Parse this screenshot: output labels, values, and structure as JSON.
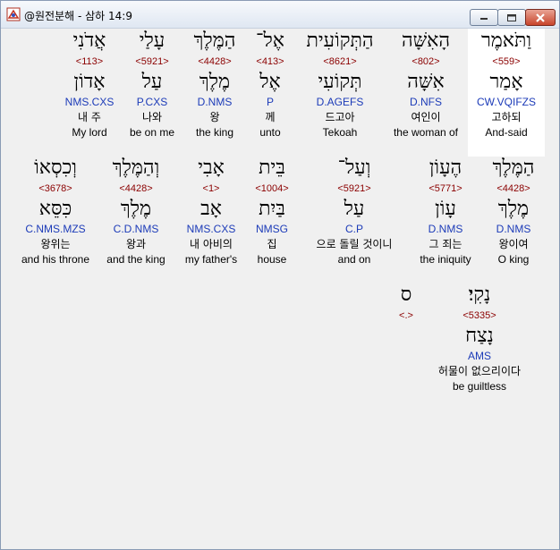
{
  "window": {
    "title": "@원전분해 - 삼하 14:9"
  },
  "rows": [
    [
      {
        "heb": "וַתֹּאמֶר",
        "strong": "<559>",
        "lemma": "אָמַר",
        "morph": "CW.VQIFZS",
        "kor": "고하되",
        "eng": "And-said"
      },
      {
        "heb": "הָאִשָּׁה",
        "strong": "<802>",
        "lemma": "אִשָּׁה",
        "morph": "D.NFS",
        "kor": "여인이",
        "eng": "the woman of"
      },
      {
        "heb": "הַתְּקוֹעִית",
        "strong": "<8621>",
        "lemma": "תְּקוֹעִי",
        "morph": "D.AGEFS",
        "kor": "드고아",
        "eng": "Tekoah"
      },
      {
        "heb": "אֶל־",
        "strong": "<413>",
        "lemma": "אֶל",
        "morph": "P",
        "kor": "께",
        "eng": "unto"
      },
      {
        "heb": "הַמֶּלֶךְ",
        "strong": "<4428>",
        "lemma": "מֶלֶךְ",
        "morph": "D.NMS",
        "kor": "왕",
        "eng": "the king"
      },
      {
        "heb": "עָלַי",
        "strong": "<5921>",
        "lemma": "עַל",
        "morph": "P.CXS",
        "kor": "나와",
        "eng": "be on me"
      },
      {
        "heb": "אֲדֹנִי",
        "strong": "<113>",
        "lemma": "אָדוֹן",
        "morph": "NMS.CXS",
        "kor": "내 주",
        "eng": "My lord"
      }
    ],
    [
      {
        "heb": "הַמֶּלֶךְ",
        "strong": "<4428>",
        "lemma": "מֶלֶךְ",
        "morph": "D.NMS",
        "kor": "왕이여",
        "eng": "O king"
      },
      {
        "heb": "הֶעָוֹן",
        "strong": "<5771>",
        "lemma": "עָוֹן",
        "morph": "D.NMS",
        "kor": "그 죄는",
        "eng": "the iniquity"
      },
      {
        "heb": "וְעַל־",
        "strong": "<5921>",
        "lemma": "עַל",
        "morph": "C.P",
        "kor": "으로 돌릴 것이니",
        "eng": "and on"
      },
      {
        "heb": "בֵּית",
        "strong": "<1004>",
        "lemma": "בַּיִת",
        "morph": "NMSG",
        "kor": "집",
        "eng": "house"
      },
      {
        "heb": "אָבִי",
        "strong": "<1>",
        "lemma": "אָב",
        "morph": "NMS.CXS",
        "kor": "내 아비의",
        "eng": "my father's"
      },
      {
        "heb": "וְהַמֶּלֶךְ",
        "strong": "<4428>",
        "lemma": "מֶלֶךְ",
        "morph": "C.D.NMS",
        "kor": "왕과",
        "eng": "and the king"
      },
      {
        "heb": "וְכִסְאוֹ",
        "strong": "<3678>",
        "lemma": "כִּסֵּא",
        "morph": "C.NMS.MZS",
        "kor": "왕위는",
        "eng": "and his throne"
      }
    ],
    [
      {
        "heb": "נָקִי׃",
        "strong": "<5335>",
        "lemma": "נָצַח",
        "morph": "AMS",
        "kor": "허물이 없으리이다",
        "eng": "be guiltless"
      },
      {
        "heb": "ס",
        "strong": "<.>",
        "lemma": "",
        "morph": "",
        "kor": "",
        "eng": ""
      }
    ]
  ]
}
